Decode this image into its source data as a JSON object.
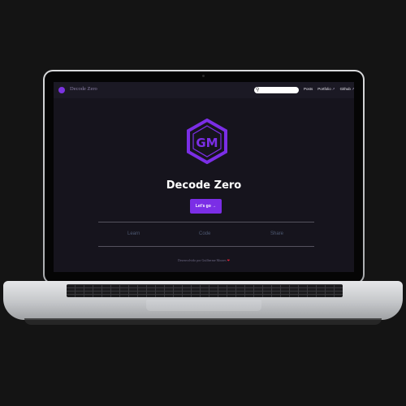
{
  "site": {
    "brand": "Decode Zero",
    "nav_links": [
      {
        "label": "Posts",
        "external": false
      },
      {
        "label": "Portfolio",
        "external": true
      },
      {
        "label": "Github",
        "external": true
      }
    ],
    "search": {
      "placeholder": ""
    },
    "hero": {
      "logo_text": "GM",
      "title": "Decode Zero",
      "cta_label": "Let's go →"
    },
    "features": [
      "Learn",
      "Code",
      "Share"
    ],
    "footer": {
      "text": "Desenvolvido por Guilherme Moraes",
      "heart": "❤"
    }
  },
  "colors": {
    "accent": "#7b2ee6",
    "background": "#16141d",
    "page": "#141414"
  },
  "icons": {
    "external": "external-link-icon",
    "search": "search-icon",
    "logo": "hexagon-logo-icon"
  }
}
